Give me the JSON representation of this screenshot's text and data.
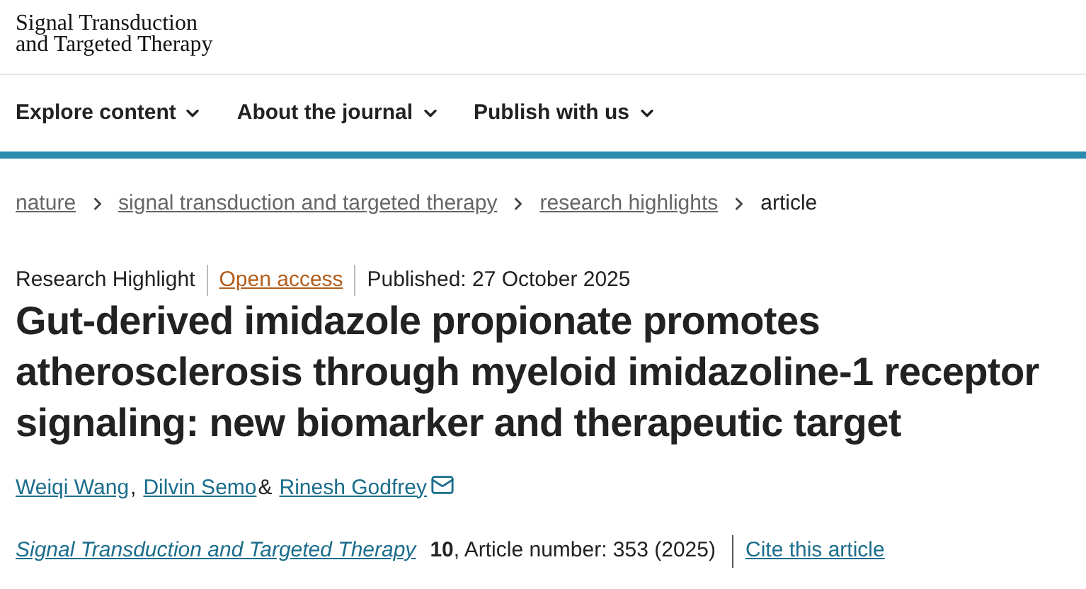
{
  "logo": {
    "line_1": "Signal Transduction",
    "line_2": "and Targeted Therapy"
  },
  "nav": [
    {
      "label": "Explore content"
    },
    {
      "label": "About the journal"
    },
    {
      "label": "Publish with us"
    }
  ],
  "breadcrumbs": [
    {
      "label": "nature",
      "current": false
    },
    {
      "label": "signal transduction and targeted therapy",
      "current": false
    },
    {
      "label": "research highlights",
      "current": false
    },
    {
      "label": "article",
      "current": true
    }
  ],
  "meta": {
    "type": "Research Highlight",
    "access": "Open access",
    "published": "Published: 27 October 2025"
  },
  "title": "Gut-derived imidazole propionate promotes atherosclerosis through myeloid imidazoline-1 receptor signaling: new biomarker and therapeutic target",
  "authors": [
    {
      "name": "Weiqi Wang",
      "after": ",",
      "email": false
    },
    {
      "name": "Dilvin Semo",
      "after": "&",
      "email": false
    },
    {
      "name": "Rinesh Godfrey",
      "email": true
    }
  ],
  "citation": {
    "journal": "Signal Transduction and Targeted Therapy",
    "details": "**10**, Article number: 353 (2025)",
    "cite_link": "Cite this article"
  }
}
